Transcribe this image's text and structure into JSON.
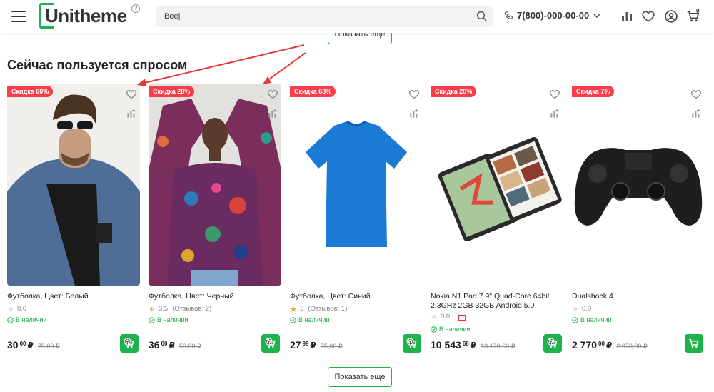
{
  "header": {
    "logo": "Unitheme",
    "search_value": "Bee|",
    "phone": "7(800)-000-00-00",
    "cart_count": "0"
  },
  "colors": {
    "brand_green": "#1db24b",
    "sale_red": "#ff3d4a"
  },
  "section": {
    "top_more_label": "Показать еще",
    "title": "Сейчас пользуется спросом",
    "bottom_more_label": "Показать еще"
  },
  "products": [
    {
      "badge": "Скидка 60%",
      "title": "Футболка, Цвет: Белый",
      "rating": "0.0",
      "reviews": "",
      "stock": "В наличии",
      "price": "30",
      "kop": "00",
      "currency": "₽",
      "old_price": "75,00 ₽",
      "icons": [
        "heart-icon",
        "compare-icon",
        "cart-icon"
      ]
    },
    {
      "badge": "Скидка 28%",
      "title": "Футболка, Цвет: Черный",
      "rating": "3.5",
      "reviews": "(Отзывов: 2)",
      "stock": "В наличии",
      "price": "36",
      "kop": "00",
      "currency": "₽",
      "old_price": "50,00 ₽",
      "icons": [
        "heart-icon",
        "compare-icon",
        "cart-icon"
      ]
    },
    {
      "badge": "Скидка 63%",
      "title": "Футболка, Цвет: Синий",
      "rating": "5",
      "reviews": "(Отзывов: 1)",
      "stock": "В наличии",
      "price": "27",
      "kop": "99",
      "currency": "₽",
      "old_price": "75,00 ₽",
      "icons": [
        "heart-icon",
        "compare-icon",
        "cart-icon"
      ]
    },
    {
      "badge": "Скидка 20%",
      "title": "Nokia N1 Pad 7.9\" Quad-Core 64bit 2.3GHz 2GB 32GB Android 5.0",
      "rating": "0.0",
      "reviews": "",
      "stock": "В наличии",
      "price": "10 543",
      "kop": "68",
      "currency": "₽",
      "old_price": "13 179,60 ₽",
      "icons": [
        "heart-icon",
        "compare-icon",
        "cart-icon"
      ]
    },
    {
      "badge": "Скидка 7%",
      "title": "Dualshock 4",
      "rating": "0.0",
      "reviews": "",
      "stock": "В наличии",
      "price": "2 770",
      "kop": "00",
      "currency": "₽",
      "old_price": "2 970,00 ₽",
      "icons": [
        "heart-icon",
        "compare-icon",
        "cart-icon"
      ]
    }
  ]
}
